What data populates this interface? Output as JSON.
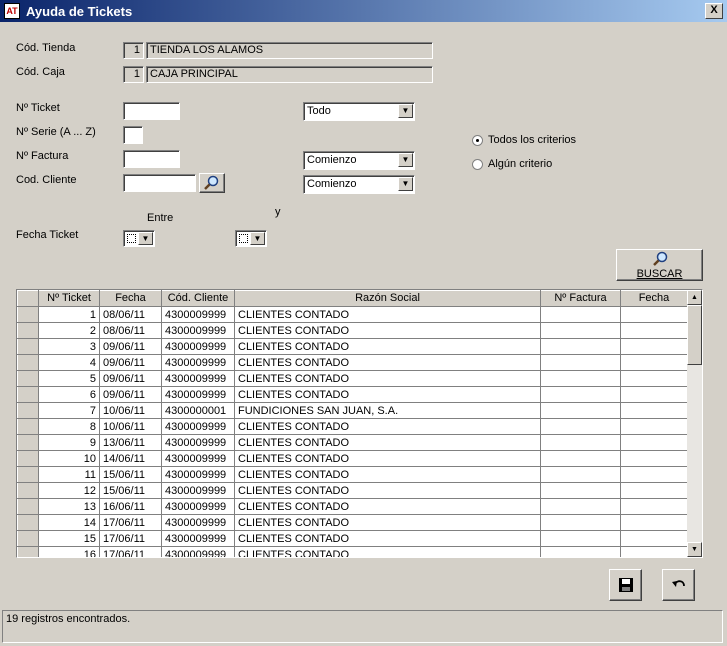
{
  "window": {
    "title": "Ayuda de Tickets",
    "close_label": "X",
    "icon_label": "AT"
  },
  "tienda": {
    "label": "Cód. Tienda",
    "code": "1",
    "name": "TIENDA LOS ALAMOS"
  },
  "caja": {
    "label": "Cód. Caja",
    "code": "1",
    "name": "CAJA PRINCIPAL"
  },
  "ticket": {
    "label": "Nº Ticket",
    "value": "",
    "mode": "Todo"
  },
  "serie": {
    "label": "Nº Serie (A ... Z)",
    "value": ""
  },
  "factura": {
    "label": "Nº Factura",
    "value": "",
    "mode": "Comienzo"
  },
  "cliente": {
    "label": "Cod. Cliente",
    "value": "",
    "mode": "Comienzo"
  },
  "fecha": {
    "label": "Fecha Ticket",
    "between_label": "Entre",
    "and_label": "y"
  },
  "criteria": {
    "all_label": "Todos los criterios",
    "any_label": "Algún criterio",
    "selected": "all"
  },
  "search_button": {
    "label": "BUSCAR"
  },
  "table": {
    "columns": [
      "Nº Ticket",
      "Fecha",
      "Cód. Cliente",
      "Razón Social",
      "Nº Factura",
      "Fecha"
    ],
    "rows": [
      {
        "ticket": "1",
        "fecha": "08/06/11",
        "cliente": "4300009999",
        "razon": "CLIENTES CONTADO",
        "factura": "",
        "ffecha": ""
      },
      {
        "ticket": "2",
        "fecha": "08/06/11",
        "cliente": "4300009999",
        "razon": "CLIENTES CONTADO",
        "factura": "",
        "ffecha": ""
      },
      {
        "ticket": "3",
        "fecha": "09/06/11",
        "cliente": "4300009999",
        "razon": "CLIENTES CONTADO",
        "factura": "",
        "ffecha": ""
      },
      {
        "ticket": "4",
        "fecha": "09/06/11",
        "cliente": "4300009999",
        "razon": "CLIENTES CONTADO",
        "factura": "",
        "ffecha": ""
      },
      {
        "ticket": "5",
        "fecha": "09/06/11",
        "cliente": "4300009999",
        "razon": "CLIENTES CONTADO",
        "factura": "",
        "ffecha": ""
      },
      {
        "ticket": "6",
        "fecha": "09/06/11",
        "cliente": "4300009999",
        "razon": "CLIENTES CONTADO",
        "factura": "",
        "ffecha": ""
      },
      {
        "ticket": "7",
        "fecha": "10/06/11",
        "cliente": "4300000001",
        "razon": "FUNDICIONES SAN JUAN, S.A.",
        "factura": "",
        "ffecha": ""
      },
      {
        "ticket": "8",
        "fecha": "10/06/11",
        "cliente": "4300009999",
        "razon": "CLIENTES CONTADO",
        "factura": "",
        "ffecha": ""
      },
      {
        "ticket": "9",
        "fecha": "13/06/11",
        "cliente": "4300009999",
        "razon": "CLIENTES CONTADO",
        "factura": "",
        "ffecha": ""
      },
      {
        "ticket": "10",
        "fecha": "14/06/11",
        "cliente": "4300009999",
        "razon": "CLIENTES CONTADO",
        "factura": "",
        "ffecha": ""
      },
      {
        "ticket": "11",
        "fecha": "15/06/11",
        "cliente": "4300009999",
        "razon": "CLIENTES CONTADO",
        "factura": "",
        "ffecha": ""
      },
      {
        "ticket": "12",
        "fecha": "15/06/11",
        "cliente": "4300009999",
        "razon": "CLIENTES CONTADO",
        "factura": "",
        "ffecha": ""
      },
      {
        "ticket": "13",
        "fecha": "16/06/11",
        "cliente": "4300009999",
        "razon": "CLIENTES CONTADO",
        "factura": "",
        "ffecha": ""
      },
      {
        "ticket": "14",
        "fecha": "17/06/11",
        "cliente": "4300009999",
        "razon": "CLIENTES CONTADO",
        "factura": "",
        "ffecha": ""
      },
      {
        "ticket": "15",
        "fecha": "17/06/11",
        "cliente": "4300009999",
        "razon": "CLIENTES CONTADO",
        "factura": "",
        "ffecha": ""
      },
      {
        "ticket": "16",
        "fecha": "17/06/11",
        "cliente": "4300009999",
        "razon": "CLIENTES CONTADO",
        "factura": "",
        "ffecha": ""
      }
    ]
  },
  "status": {
    "text": "19 registros encontrados."
  },
  "icons": {
    "save": "floppy-disk-icon",
    "undo": "undo-arrow-icon",
    "search": "magnifier-icon"
  }
}
